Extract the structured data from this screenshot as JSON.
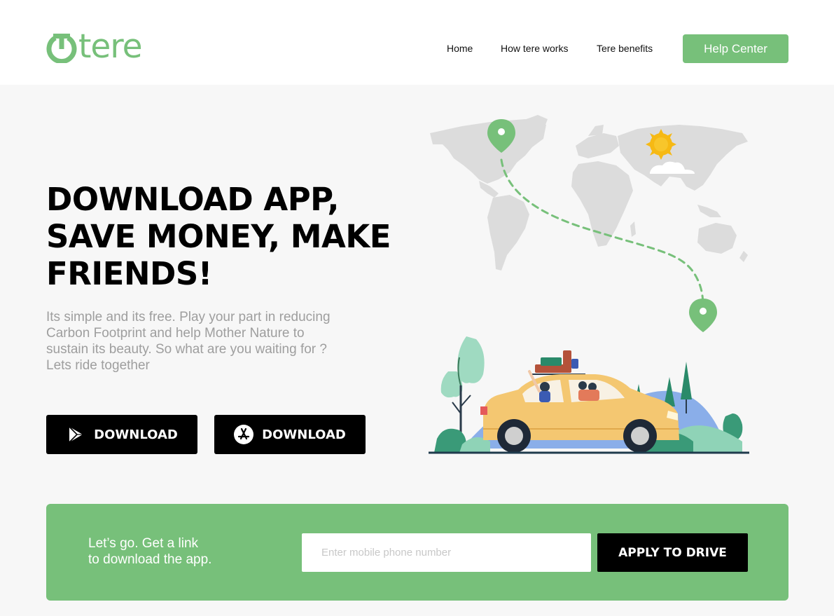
{
  "header": {
    "logo_text": "tere",
    "nav": [
      {
        "label": "Home"
      },
      {
        "label": "How tere works"
      },
      {
        "label": "Tere benefits"
      }
    ],
    "help_button": "Help Center"
  },
  "hero": {
    "headline_lines": [
      "DOWNLOAD APP,",
      "SAVE MONEY, MAKE",
      "FRIENDS!"
    ],
    "subtext_lines": [
      "Its simple and its free. Play your part in reducing",
      "Carbon Footprint and help Mother Nature to",
      "sustain its beauty. So what are you waiting for ?",
      "Lets ride together"
    ],
    "download_buttons": [
      {
        "label": "DOWNLOAD",
        "icon": "google-play-icon"
      },
      {
        "label": "DOWNLOAD",
        "icon": "app-store-icon"
      }
    ]
  },
  "cta": {
    "text_lines": [
      "Let’s go. Get a link",
      "to download the app."
    ],
    "phone_placeholder": "Enter mobile phone number",
    "apply_button": "APPLY TO DRIVE"
  },
  "colors": {
    "brand_green": "#77c07a",
    "black": "#000000",
    "background": "#f7f7f7"
  }
}
